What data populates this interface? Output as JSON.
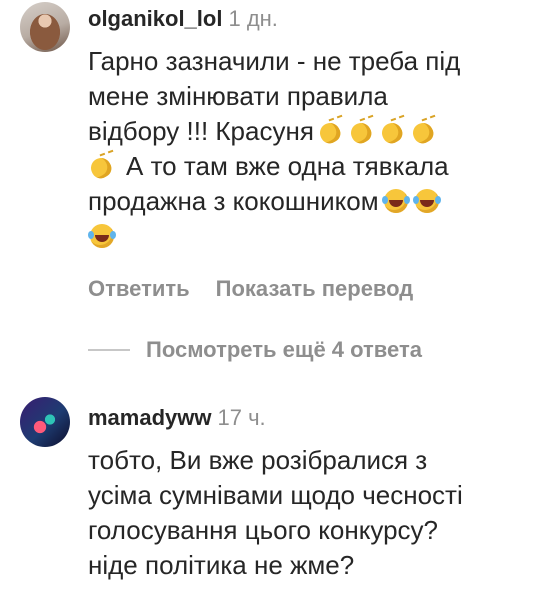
{
  "comments": [
    {
      "username": "olganikol_lol",
      "time": "1 дн.",
      "line1": "Гарно зазначили - не треба під",
      "line2": "мене змінювати правила",
      "line3": "відбору !!! Красуня",
      "line4": "А то там вже одна тявкала",
      "line5": "продажна з кокошником",
      "reply_label": "Ответить",
      "translate_label": "Показать перевод",
      "view_replies_label": "Посмотреть ещё 4 ответа"
    },
    {
      "username": "mamadyww",
      "time": "17 ч.",
      "line1": "тобто, Ви вже розібралися з",
      "line2": "усіма сумнівами щодо чесності",
      "line3": "голосування цього конкурсу?",
      "line4": "ніде політика не жме?"
    }
  ],
  "icons": {
    "clap": "clapping-hands-emoji",
    "laugh": "tears-of-joy-emoji"
  },
  "colors": {
    "text": "#262626",
    "secondary": "#8e8e8e"
  }
}
